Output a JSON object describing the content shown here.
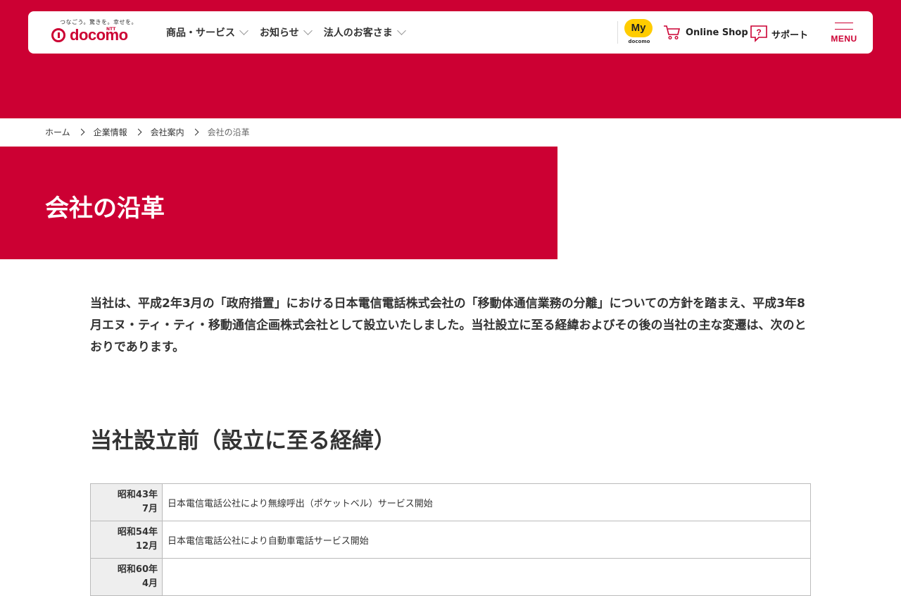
{
  "header": {
    "tagline": "つなごう。驚きを。幸せを。",
    "logo_sub": "NTT",
    "logo_text": "docomo",
    "nav": [
      {
        "label": "商品・サービス"
      },
      {
        "label": "お知らせ"
      },
      {
        "label": "法人のお客さま"
      }
    ],
    "my": {
      "badge": "My",
      "sub": "docomo"
    },
    "online_shop": "Online Shop",
    "support": "サポート",
    "menu": "MENU"
  },
  "breadcrumb": [
    "ホーム",
    "企業情報",
    "会社案内",
    "会社の沿革"
  ],
  "page_title": "会社の沿革",
  "intro": "当社は、平成2年3月の「政府措置」における日本電信電話株式会社の「移動体通信業務の分離」についての方針を踏まえ、平成3年8月エヌ・ティ・ティ・移動通信企画株式会社として設立いたしました。当社設立に至る経緯およびその後の当社の主な変遷は、次のとおりであります。",
  "section": {
    "title": "当社設立前（設立に至る経緯）",
    "rows": [
      {
        "date_1": "昭和43年",
        "date_2": "7月",
        "text": "日本電信電話公社により無線呼出（ポケットベル）サービス開始"
      },
      {
        "date_1": "昭和54年",
        "date_2": "12月",
        "text": "日本電信電話公社により自動車電話サービス開始"
      },
      {
        "date_1": "昭和60年",
        "date_2": "4月",
        "text": ""
      }
    ]
  },
  "colors": {
    "brand": "#cc0033",
    "my_badge": "#ffcc00"
  }
}
